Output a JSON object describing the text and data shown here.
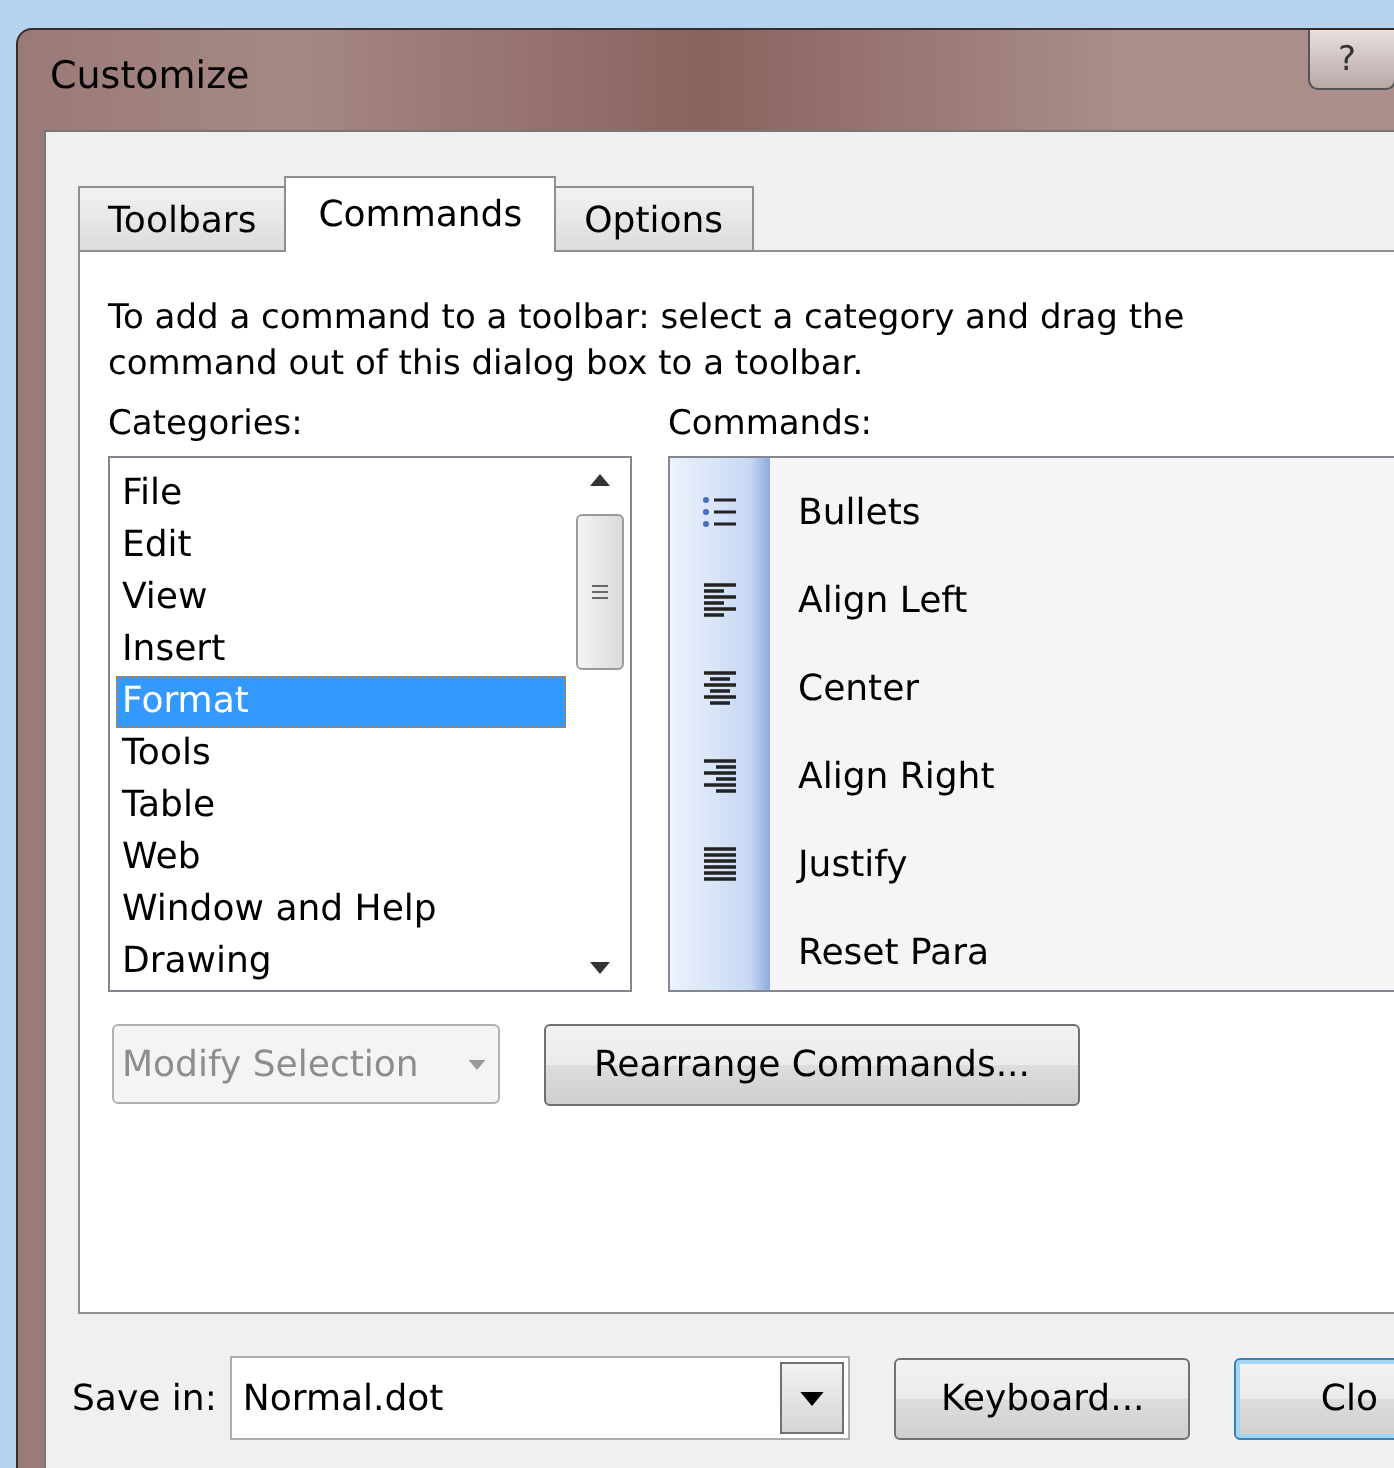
{
  "window": {
    "title": "Customize",
    "help_button": "?"
  },
  "tabs": [
    {
      "label": "Toolbars",
      "selected": false
    },
    {
      "label": "Commands",
      "selected": true
    },
    {
      "label": "Options",
      "selected": false
    }
  ],
  "instructions": "To add a command to a toolbar: select a category and drag the command out of this dialog box to a toolbar.",
  "categories": {
    "label": "Categories:",
    "items": [
      {
        "label": "File",
        "selected": false
      },
      {
        "label": "Edit",
        "selected": false
      },
      {
        "label": "View",
        "selected": false
      },
      {
        "label": "Insert",
        "selected": false
      },
      {
        "label": "Format",
        "selected": true
      },
      {
        "label": "Tools",
        "selected": false
      },
      {
        "label": "Table",
        "selected": false
      },
      {
        "label": "Web",
        "selected": false
      },
      {
        "label": "Window and Help",
        "selected": false
      },
      {
        "label": "Drawing",
        "selected": false
      }
    ]
  },
  "commands": {
    "label": "Commands:",
    "items": [
      {
        "label": "Bullets",
        "kind": "bullets"
      },
      {
        "label": "Align Left",
        "kind": "align-left"
      },
      {
        "label": "Center",
        "kind": "center"
      },
      {
        "label": "Align Right",
        "kind": "align-right"
      },
      {
        "label": "Justify",
        "kind": "justify"
      },
      {
        "label": "Reset Para",
        "kind": "none"
      }
    ]
  },
  "modify_selection": {
    "label": "Modify Selection",
    "disabled": true
  },
  "rearrange_button": "Rearrange Commands...",
  "save_in": {
    "label": "Save in:",
    "value": "Normal.dot"
  },
  "keyboard_button": "Keyboard...",
  "close_button": "Clo"
}
